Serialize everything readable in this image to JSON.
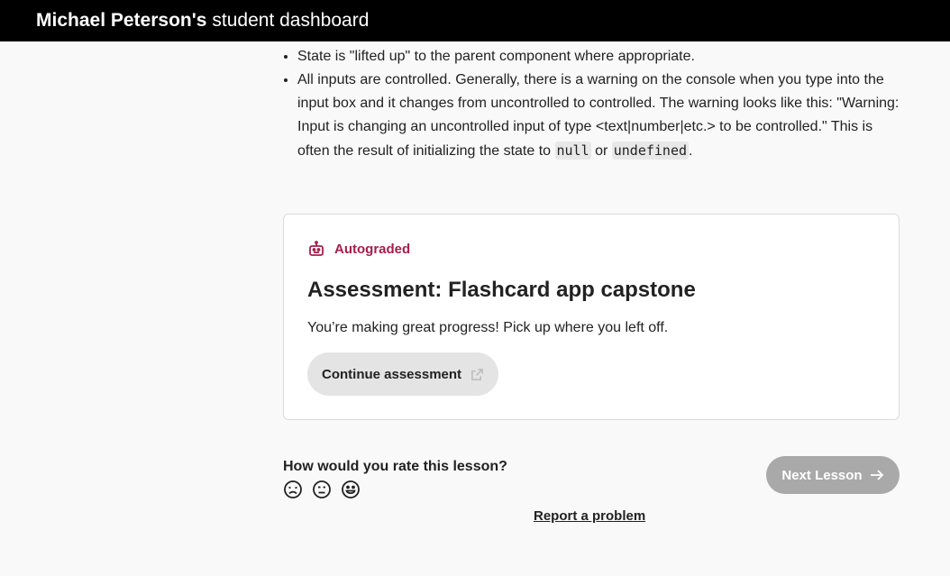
{
  "header": {
    "name": "Michael Peterson's",
    "suffix": "student dashboard"
  },
  "lesson": {
    "bullets": [
      {
        "text": "State is \"lifted up\" to the parent component where appropriate."
      },
      {
        "text_before": "All inputs are controlled. Generally, there is a warning on the console when you type into the input box and it changes from uncontrolled to controlled. The warning looks like this: \"Warning: Input is changing an uncontrolled input of type <text|number|etc.> to be controlled.\" This is often the result of initializing the state to ",
        "code1": "null",
        "or": " or ",
        "code2": "undefined",
        "end": "."
      }
    ]
  },
  "assessment": {
    "badge": "Autograded",
    "title": "Assessment: Flashcard app capstone",
    "message": "You’re making great progress! Pick up where you left off.",
    "button_label": "Continue assessment"
  },
  "rating": {
    "question": "How would you rate this lesson?",
    "faces": [
      "sad-face-icon",
      "neutral-face-icon",
      "happy-face-icon"
    ]
  },
  "next_button": "Next Lesson",
  "report_link": "Report a problem",
  "colors": {
    "accent": "#a41f4c",
    "next_button_bg": "#a9a9a9",
    "topbar_bg": "#000000"
  }
}
